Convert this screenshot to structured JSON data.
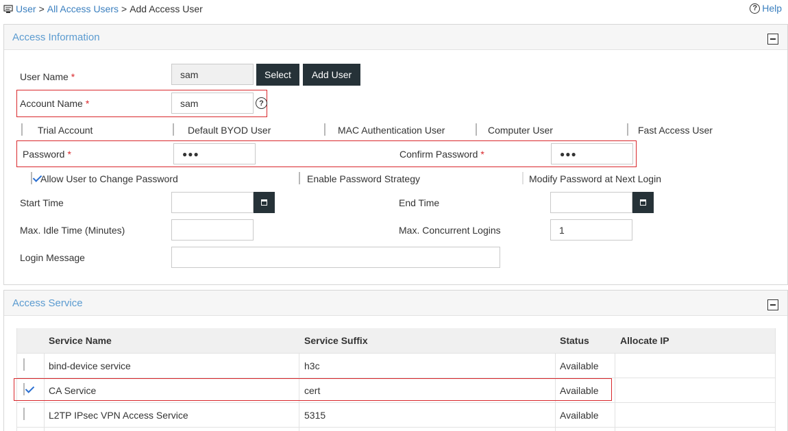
{
  "breadcrumb": {
    "items": [
      "User",
      "All Access Users"
    ],
    "separator": ">",
    "current": "Add Access User"
  },
  "help": {
    "label": "Help"
  },
  "access_info": {
    "title": "Access Information",
    "user_name": {
      "label": "User Name",
      "required": "*",
      "value": "sam"
    },
    "select_button": "Select",
    "add_user_button": "Add User",
    "account_name": {
      "label": "Account Name",
      "required": "*",
      "value": "sam"
    },
    "hint_icon": "?",
    "checkboxes": {
      "trial": {
        "label": "Trial Account",
        "checked": false
      },
      "byod": {
        "label": "Default BYOD User",
        "checked": false
      },
      "mac": {
        "label": "MAC Authentication User",
        "checked": false
      },
      "computer": {
        "label": "Computer User",
        "checked": false
      },
      "fast": {
        "label": "Fast Access User",
        "checked": false
      }
    },
    "password": {
      "label": "Password",
      "required": "*",
      "value": "●●●"
    },
    "confirm_password": {
      "label": "Confirm Password",
      "required": "*",
      "value": "●●●"
    },
    "allow_change": {
      "label": "Allow User to Change Password",
      "checked": true
    },
    "enable_strategy": {
      "label": "Enable Password Strategy",
      "checked": false
    },
    "modify_next": {
      "label": "Modify Password at Next Login",
      "checked": false,
      "disabled": true
    },
    "start_time": {
      "label": "Start Time",
      "value": ""
    },
    "end_time": {
      "label": "End Time",
      "value": ""
    },
    "max_idle": {
      "label": "Max. Idle Time (Minutes)",
      "value": ""
    },
    "max_logins": {
      "label": "Max. Concurrent Logins",
      "value": "1"
    },
    "login_message": {
      "label": "Login Message",
      "value": ""
    }
  },
  "access_service": {
    "title": "Access Service",
    "columns": [
      "Service Name",
      "Service Suffix",
      "Status",
      "Allocate IP"
    ],
    "rows": [
      {
        "name": "bind-device service",
        "suffix": "h3c",
        "status": "Available",
        "checked": false
      },
      {
        "name": "CA Service",
        "suffix": "cert",
        "status": "Available",
        "checked": true
      },
      {
        "name": "L2TP IPsec VPN Access Service",
        "suffix": "5315",
        "status": "Available",
        "checked": false
      }
    ]
  },
  "colors": {
    "accent": "#3a7fbf",
    "title": "#5b9bd0",
    "button": "#263238",
    "highlight": "#d9262a",
    "check": "#2a6fd1"
  }
}
